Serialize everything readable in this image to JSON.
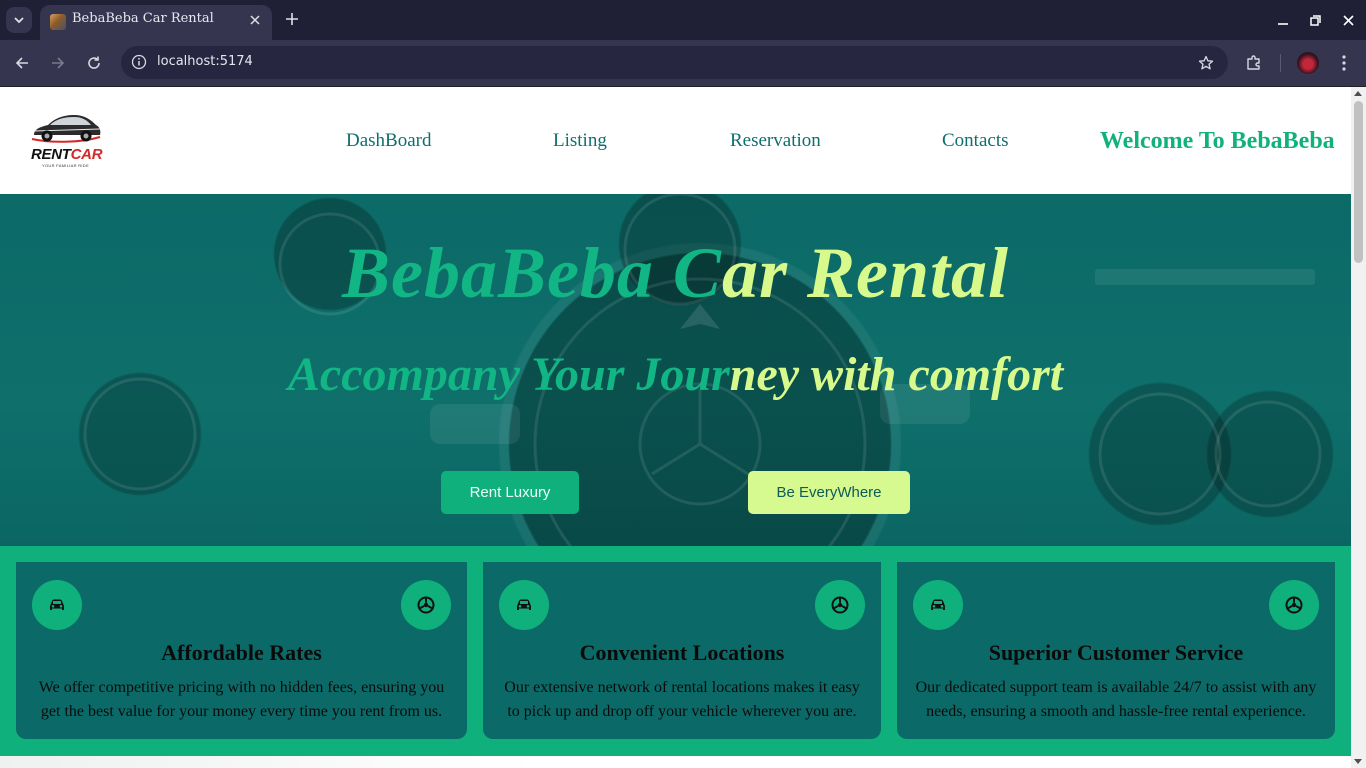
{
  "browser": {
    "tab_title": "BebaBeba Car Rental",
    "url": "localhost:5174"
  },
  "logo": {
    "brand_rent": "RENT",
    "brand_car": "CAR",
    "tagline": "YOUR FAMILIAR RIDE"
  },
  "nav": {
    "items": [
      "DashBoard",
      "Listing",
      "Reservation",
      "Contacts"
    ],
    "welcome": "Welcome To BebaBeba"
  },
  "hero": {
    "title_part1": "BebaBeba C",
    "title_part2": "ar Rental",
    "subtitle_part1": "Accompany Your Jour",
    "subtitle_part2": "ney with comfort",
    "primary_button": "Rent Luxury",
    "secondary_button": "Be EveryWhere"
  },
  "features": [
    {
      "title": "Affordable Rates",
      "text": "We offer competitive pricing with no hidden fees, ensuring you get the best value for your money every time you rent from us."
    },
    {
      "title": "Convenient Locations",
      "text": "Our extensive network of rental locations makes it easy to pick up and drop off your vehicle wherever you are."
    },
    {
      "title": "Superior Customer Service",
      "text": "Our dedicated support team is available 24/7 to assist with any needs, ensuring a smooth and hassle-free rental experience."
    }
  ],
  "colors": {
    "teal": "#0b6a67",
    "green": "#10b07c",
    "lime": "#d8f98c"
  }
}
